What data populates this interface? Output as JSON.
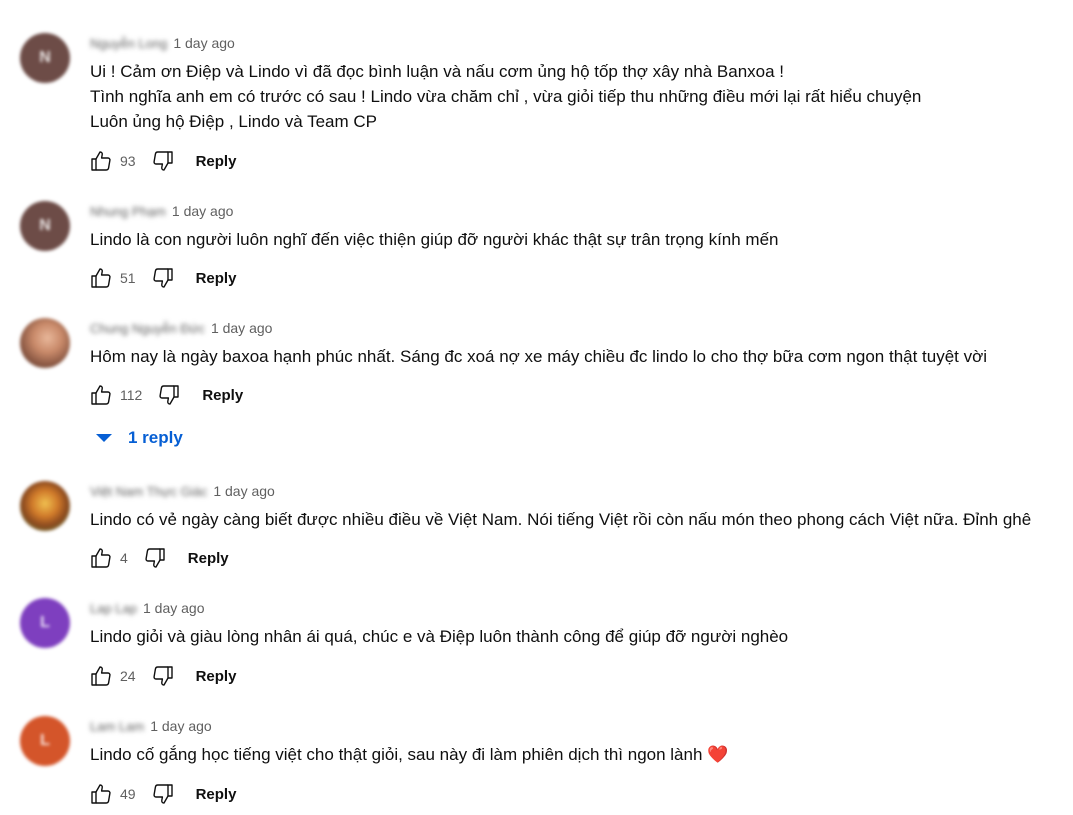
{
  "comments": [
    {
      "author": "Nguyễn Long",
      "avatar_letter": "N",
      "avatar_color": "#6d4c47",
      "time": "1 day ago",
      "lines": [
        "Ui ! Cảm ơn Điệp và Lindo vì đã đọc bình luận và nấu cơm ủng hộ tốp thợ xây nhà Banxoa !",
        "Tình nghĩa anh em có trước có sau ! Lindo vừa chăm chỉ , vừa giỏi tiếp thu những điều mới lại rất hiểu chuyện",
        "Luôn ủng hộ Điệp , Lindo và Team CP"
      ],
      "likes": "93",
      "reply_label": "Reply"
    },
    {
      "author": "Nhung Phạm",
      "avatar_letter": "N",
      "avatar_color": "#6d4c47",
      "time": "1 day ago",
      "lines": [
        "Lindo là con người luôn nghĩ đến việc thiện giúp đỡ người khác thật sự trân trọng kính mến"
      ],
      "likes": "51",
      "reply_label": "Reply"
    },
    {
      "author": "Chung Nguyễn Đức",
      "avatar_letter": "",
      "avatar_color": "#b07a62",
      "time": "1 day ago",
      "lines": [
        "Hôm nay là ngày baxoa hạnh phúc nhất. Sáng đc xoá nợ xe máy chiều đc lindo lo cho thợ bữa cơm ngon thật tuyệt vời"
      ],
      "likes": "112",
      "reply_label": "Reply",
      "replies_toggle": "1 reply"
    },
    {
      "author": "Việt Nam Thực Giác",
      "avatar_letter": "",
      "avatar_color": "#c97a2a",
      "time": "1 day ago",
      "lines": [
        "Lindo có vẻ ngày càng biết được nhiều điều về Việt Nam. Nói tiếng Việt rồi còn nấu món theo phong cách Việt nữa. Đỉnh ghê"
      ],
      "likes": "4",
      "reply_label": "Reply"
    },
    {
      "author": "Lap Lap",
      "avatar_letter": "L",
      "avatar_color": "#7e3fbf",
      "time": "1 day ago",
      "lines": [
        "Lindo giỏi và giàu lòng nhân ái quá, chúc e và Điệp luôn thành công để giúp đỡ người nghèo"
      ],
      "likes": "24",
      "reply_label": "Reply"
    },
    {
      "author": "Lam Lam",
      "avatar_letter": "L",
      "avatar_color": "#d4552a",
      "time": "1 day ago",
      "lines": [
        "Lindo cố gắng học tiếng việt cho thật giỏi, sau này đi làm phiên dịch thì ngon lành"
      ],
      "emoji": "❤️",
      "likes": "49",
      "reply_label": "Reply"
    }
  ]
}
